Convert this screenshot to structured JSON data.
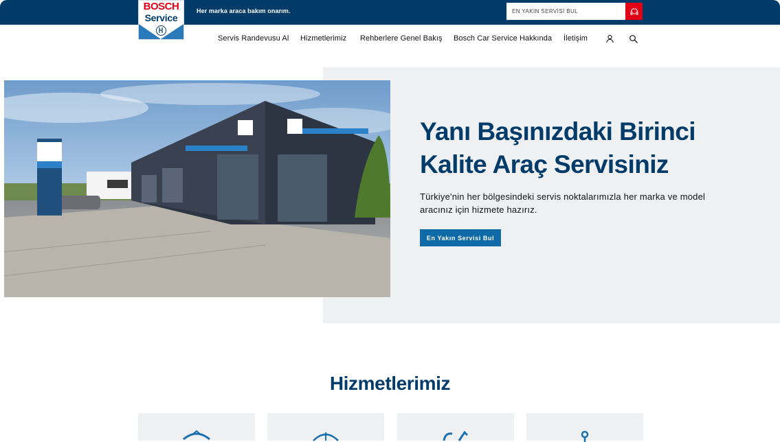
{
  "brand": {
    "logo_word": "BOSCH",
    "logo_sub": "Service",
    "tagline": "Her marka araca bakım onarım."
  },
  "search": {
    "placeholder": "EN YAKIN SERVİSİ BUL",
    "button_icon": "car-icon"
  },
  "nav": {
    "items": [
      "Servis Randevusu Al",
      "Hizmetlerimiz",
      "Rehberlere Genel Bakış",
      "Bosch Car Service Hakkında",
      "İletişim"
    ],
    "icons": [
      "user-icon",
      "search-icon"
    ]
  },
  "hero": {
    "image_icon": "workshop-photo",
    "title": "Yanı Başınızdaki Birinci Kalite Araç Servisiniz",
    "text": "Türkiye'nin her bölgesindeki servis noktalarımızla her marka ve model aracınız için hizmete hazırız.",
    "cta": "En Yakın Servisi Bul"
  },
  "services": {
    "title": "Hizmetlerimiz",
    "cards": [
      {
        "icon": "steering-icon"
      },
      {
        "icon": "gauge-icon"
      },
      {
        "icon": "wrench-icon"
      },
      {
        "icon": "person-icon"
      }
    ]
  },
  "colors": {
    "primary": "#003b6a",
    "accent_red": "#e20015",
    "button_blue": "#0f6ba8",
    "panel_gray": "#eff0f1"
  }
}
